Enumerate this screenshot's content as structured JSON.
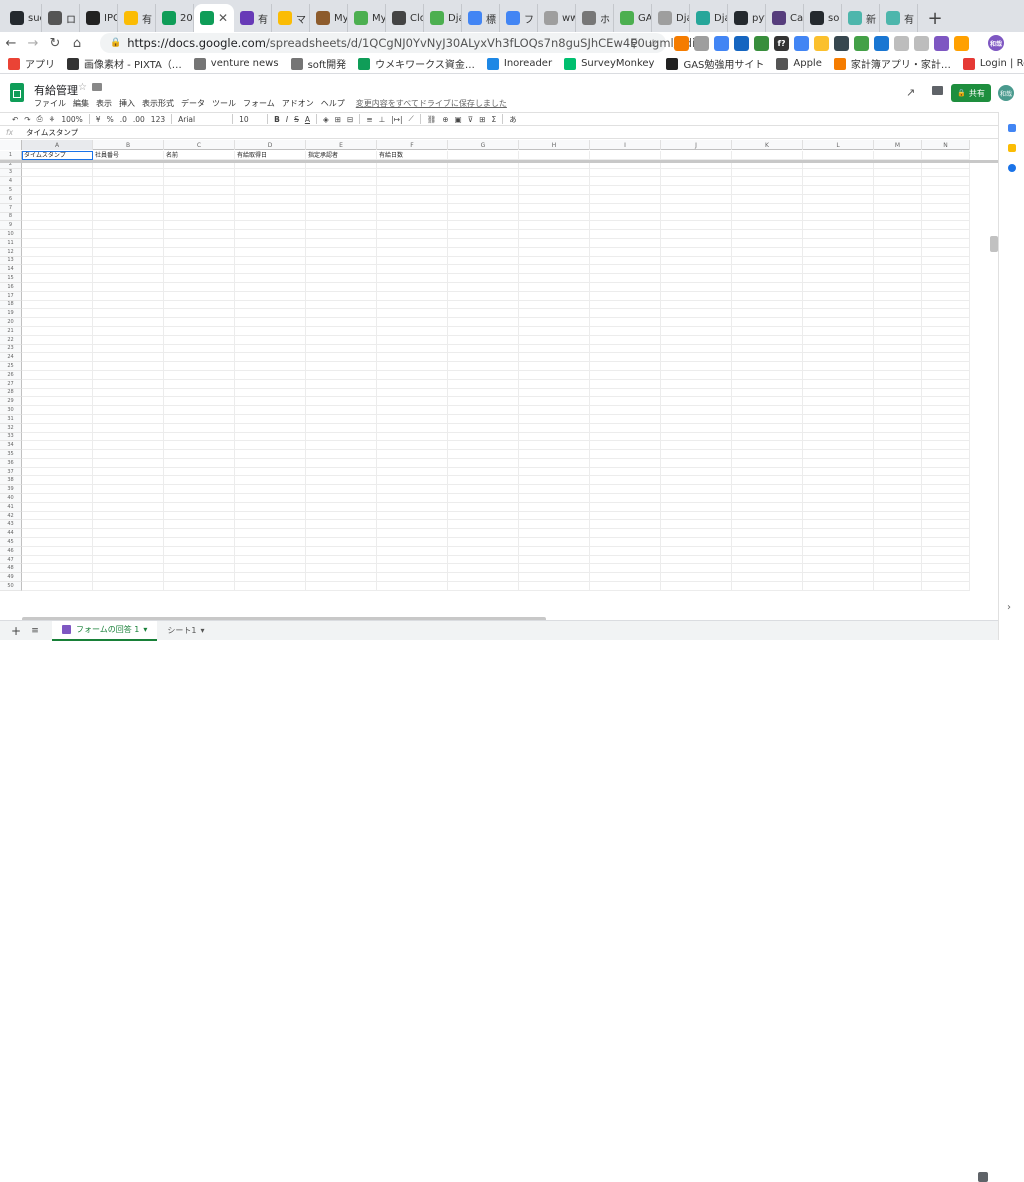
{
  "browser": {
    "tabs": [
      {
        "label": "suc",
        "icon": "github-icon",
        "color": "#24292e"
      },
      {
        "label": "ロ",
        "icon": "ry-icon",
        "color": "#555555"
      },
      {
        "label": "IPC",
        "icon": "ipo-icon",
        "color": "#222222"
      },
      {
        "label": "有",
        "icon": "drive-icon",
        "color": "#fbbc04"
      },
      {
        "label": "20",
        "icon": "sheets-icon",
        "color": "#0f9d58"
      },
      {
        "label": "",
        "icon": "sheets-icon",
        "color": "#0f9d58",
        "active": true
      },
      {
        "label": "有",
        "icon": "forms-icon",
        "color": "#673ab7"
      },
      {
        "label": "マ",
        "icon": "drive-icon",
        "color": "#fbbc04"
      },
      {
        "label": "My",
        "icon": "w-icon",
        "color": "#8d5b2c"
      },
      {
        "label": "My",
        "icon": "circle-green-icon",
        "color": "#4caf50"
      },
      {
        "label": "Clo",
        "icon": "clock-icon",
        "color": "#444444"
      },
      {
        "label": "Dja",
        "icon": "circle-green-icon",
        "color": "#4caf50"
      },
      {
        "label": "標",
        "icon": "cloud-icon",
        "color": "#4285f4"
      },
      {
        "label": "フ",
        "icon": "cloud-icon",
        "color": "#4285f4"
      },
      {
        "label": "ww",
        "icon": "google-icon",
        "color": "#9e9e9e"
      },
      {
        "label": "ホ",
        "icon": "gear-icon",
        "color": "#777777"
      },
      {
        "label": "GA",
        "icon": "circle-green-icon",
        "color": "#4caf50"
      },
      {
        "label": "Dja",
        "icon": "doc-icon",
        "color": "#9e9e9e"
      },
      {
        "label": "Dja",
        "icon": "teal-icon",
        "color": "#26a69a"
      },
      {
        "label": "pyt",
        "icon": "github-icon",
        "color": "#24292e"
      },
      {
        "label": "Ca",
        "icon": "b-icon",
        "color": "#563d7c"
      },
      {
        "label": "so",
        "icon": "github-icon",
        "color": "#24292e"
      },
      {
        "label": "新",
        "icon": "chart-icon",
        "color": "#4db6ac"
      },
      {
        "label": "有",
        "icon": "chart-icon",
        "color": "#4db6ac"
      }
    ],
    "close_glyph": "✕",
    "newtab_glyph": "+",
    "url_host": "https://docs.google.com",
    "url_path": "/spreadsheets/d/1QCgNJ0YvNyJ30ALyxVh3fLOQs7n8guSJhCEw4E0ugml/edi...",
    "back_glyph": "←",
    "forward_glyph": "→",
    "reload_glyph": "↻",
    "home_glyph": "⌂",
    "zoom_glyph": "⚲",
    "star_glyph": "☆",
    "extension_labels": [
      "",
      "",
      "",
      "",
      "",
      "f?",
      "",
      "",
      "",
      "",
      "",
      "",
      "",
      "",
      ""
    ],
    "extension_colors": [
      "#f57c00",
      "#9e9e9e",
      "#4285f4",
      "#1565c0",
      "#388e3c",
      "#333333",
      "#4285f4",
      "#fbc02d",
      "#37474f",
      "#43a047",
      "#1976d2",
      "#bdbdbd",
      "#bdbdbd",
      "#7e57c2",
      "#ffa000"
    ],
    "profile_label": "和哉",
    "bookmarks": [
      {
        "label": "アプリ",
        "color": "#ea4335"
      },
      {
        "label": "画像素材 - PIXTA（…",
        "color": "#333333"
      },
      {
        "label": "venture news",
        "color": "#757575"
      },
      {
        "label": "soft開発",
        "color": "#757575"
      },
      {
        "label": "ウメキワークス資金…",
        "color": "#0f9d58"
      },
      {
        "label": "Inoreader",
        "color": "#1e88e5"
      },
      {
        "label": "SurveyMonkey",
        "color": "#00bf6f"
      },
      {
        "label": "GAS勉強用サイト",
        "color": "#222222"
      },
      {
        "label": "Apple",
        "color": "#555555"
      },
      {
        "label": "家計簿アプリ・家計…",
        "color": "#f57c00"
      },
      {
        "label": "Login | Redash",
        "color": "#e53935"
      }
    ]
  },
  "doc": {
    "title": "有給管理",
    "star_glyph": "☆",
    "menus": [
      "ファイル",
      "編集",
      "表示",
      "挿入",
      "表示形式",
      "データ",
      "ツール",
      "フォーム",
      "アドオン",
      "ヘルプ"
    ],
    "saved_status": "変更内容をすべてドライブに保存しました",
    "share_label": "共有",
    "avatar_label": "和哉",
    "trend_glyph": "↗"
  },
  "format_toolbar": {
    "undo": "↶",
    "redo": "↷",
    "print": "⎙",
    "paint": "⚘",
    "zoom": "100%",
    "currency": "¥",
    "percent": "%",
    "dec_less": ".0",
    "dec_more": ".00",
    "number_format": "123",
    "font": "Arial",
    "font_size": "10",
    "bold": "B",
    "italic": "I",
    "strike": "S",
    "text_color": "A",
    "fill": "◈",
    "borders": "⊞",
    "merge": "⊟",
    "halign": "≡",
    "valign": "⊥",
    "wrap": "|↦|",
    "rotate": "⟋",
    "link": "⛓",
    "comment": "⊕",
    "chart": "▣",
    "filter": "⊽",
    "filter_view": "⊞",
    "functions": "Σ",
    "input_tools": "あ"
  },
  "formula_bar": {
    "fx": "fx",
    "value": "タイムスタンプ"
  },
  "grid": {
    "columns": [
      "A",
      "B",
      "C",
      "D",
      "E",
      "F",
      "G",
      "H",
      "I",
      "J",
      "K",
      "L",
      "M",
      "N"
    ],
    "column_widths": [
      71,
      71,
      71,
      71,
      71,
      71,
      71,
      71,
      71,
      71,
      71,
      71,
      48,
      48
    ],
    "header_row": [
      "タイムスタンプ",
      "社員番号",
      "名前",
      "有給取得日",
      "指定承認者",
      "有給日数",
      "",
      "",
      "",
      "",
      "",
      "",
      "",
      ""
    ],
    "row_count": 50
  },
  "sheets": {
    "add_glyph": "+",
    "list_glyph": "≡",
    "tab1_label": "フォームの回答 1",
    "tab2_label": "シート1",
    "dropdown_glyph": "▾"
  }
}
